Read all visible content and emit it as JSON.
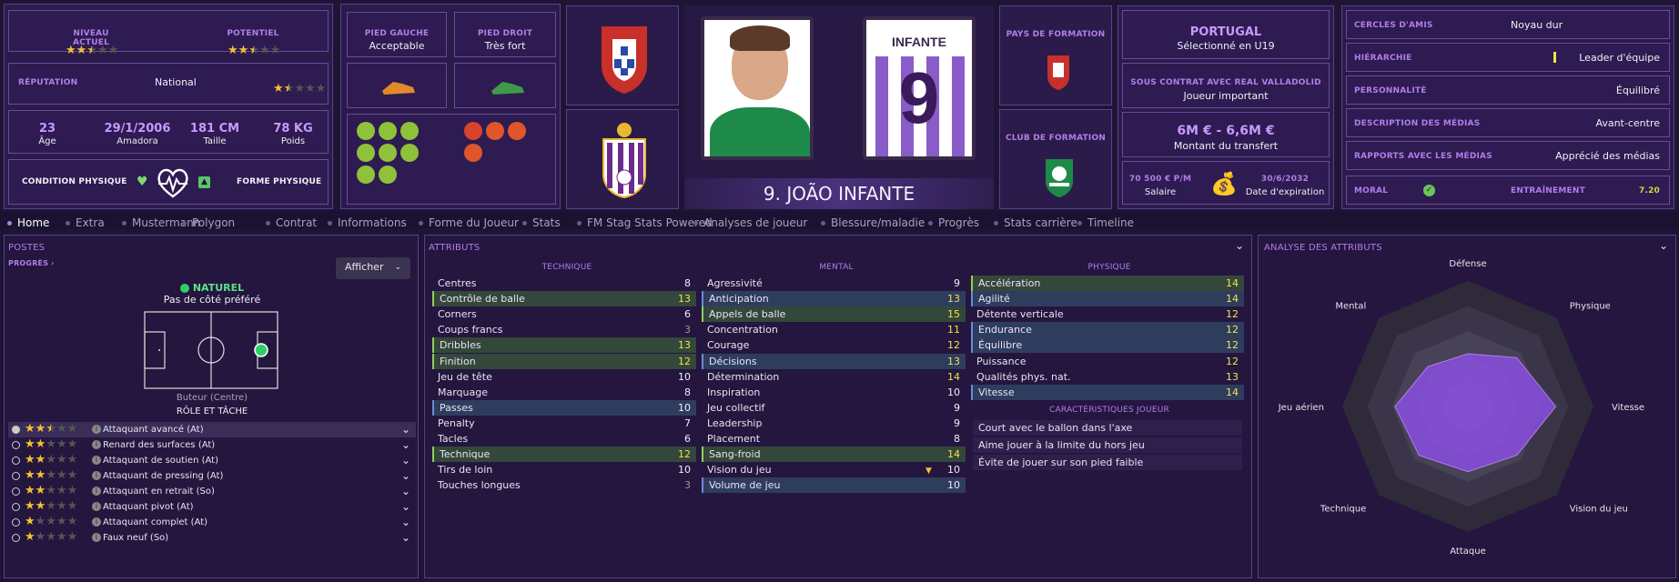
{
  "profile": {
    "current_level_label": "NIVEAU ACTUEL",
    "potential_label": "POTENTIEL",
    "current_stars": 2.5,
    "potential_stars": 2.5,
    "reputation_label": "RÉPUTATION",
    "reputation_value": "National",
    "reputation_stars": 1.5,
    "age": "23",
    "age_label": "Âge",
    "dob": "29/1/2006",
    "birthplace": "Amadora",
    "height": "181 CM",
    "height_label": "Taille",
    "weight": "78 KG",
    "weight_label": "Poids",
    "condition_label": "CONDITION PHYSIQUE",
    "form_label": "FORME PHYSIQUE"
  },
  "feet": {
    "left_label": "PIED GAUCHE",
    "left_value": "Acceptable",
    "right_label": "PIED DROIT",
    "right_value": "Très fort"
  },
  "player": {
    "name": "9. JOÃO INFANTE",
    "shirt_name": "INFANTE",
    "shirt_number": "9"
  },
  "formation": {
    "country_label": "PAYS DE FORMATION",
    "club_label": "CLUB DE FORMATION"
  },
  "contract": {
    "nation": "PORTUGAL",
    "nation_sub": "Sélectionné en U19",
    "contract_label": "SOUS CONTRAT AVEC REAL VALLADOLID",
    "contract_value": "Joueur important",
    "transfer_value": "6M € - 6,6M €",
    "transfer_label": "Montant du transfert",
    "salary": "70 500 € P/M",
    "salary_label": "Salaire",
    "expiry": "30/6/2032",
    "expiry_label": "Date d'expiration"
  },
  "social": {
    "rows": [
      {
        "label": "CERCLES D'AMIS",
        "value": "Noyau dur"
      },
      {
        "label": "HIÉRARCHIE",
        "value": "Leader d'équipe"
      },
      {
        "label": "PERSONNALITÉ",
        "value": "Équilibré"
      },
      {
        "label": "DESCRIPTION DES MÉDIAS",
        "value": "Avant-centre"
      },
      {
        "label": "RAPPORTS AVEC LES MÉDIAS",
        "value": "Apprécié des médias"
      }
    ],
    "morale_label": "MORAL",
    "training_label": "ENTRAÎNEMENT",
    "training_value": "7.20"
  },
  "tabs": [
    "Home",
    "Extra",
    "Mustermann",
    "Polygon",
    "Contrat",
    "Informations",
    "Forme du Joueur",
    "Stats",
    "FM Stag Stats Powered",
    "Analyses de joueur",
    "Blessure/maladie",
    "Progrès",
    "Stats carrière",
    "Timeline"
  ],
  "positions": {
    "title": "POSTES",
    "progress_link": "PROGRÈS",
    "show_button": "Afficher",
    "natural": "NATUREL",
    "side_pref": "Pas de côté préféré",
    "position_name": "Buteur (Centre)",
    "role_title": "RÔLE ET TÂCHE",
    "roles": [
      {
        "name": "Attaquant avancé (At)",
        "stars": 2.5
      },
      {
        "name": "Renard des surfaces (At)",
        "stars": 2
      },
      {
        "name": "Attaquant de soutien (At)",
        "stars": 2
      },
      {
        "name": "Attaquant de pressing (At)",
        "stars": 2
      },
      {
        "name": "Attaquant en retrait (So)",
        "stars": 2
      },
      {
        "name": "Attaquant pivot (At)",
        "stars": 2
      },
      {
        "name": "Attaquant complet (At)",
        "stars": 1
      },
      {
        "name": "Faux neuf (So)",
        "stars": 1
      }
    ]
  },
  "attributes": {
    "title": "ATTRIBUTS",
    "technique_title": "TECHNIQUE",
    "mental_title": "MENTAL",
    "physique_title": "PHYSIQUE",
    "traits_title": "CARACTÉRISTIQUES JOUEUR",
    "technique": [
      {
        "n": "Centres",
        "v": "8",
        "h": ""
      },
      {
        "n": "Contrôle de balle",
        "v": "13",
        "h": "g"
      },
      {
        "n": "Corners",
        "v": "6",
        "h": ""
      },
      {
        "n": "Coups francs",
        "v": "3",
        "h": ""
      },
      {
        "n": "Dribbles",
        "v": "13",
        "h": "g"
      },
      {
        "n": "Finition",
        "v": "12",
        "h": "g"
      },
      {
        "n": "Jeu de tête",
        "v": "10",
        "h": ""
      },
      {
        "n": "Marquage",
        "v": "8",
        "h": ""
      },
      {
        "n": "Passes",
        "v": "10",
        "h": "b"
      },
      {
        "n": "Penalty",
        "v": "7",
        "h": ""
      },
      {
        "n": "Tacles",
        "v": "6",
        "h": ""
      },
      {
        "n": "Technique",
        "v": "12",
        "h": "g"
      },
      {
        "n": "Tirs de loin",
        "v": "10",
        "h": ""
      },
      {
        "n": "Touches longues",
        "v": "3",
        "h": ""
      }
    ],
    "mental": [
      {
        "n": "Agressivité",
        "v": "9",
        "h": ""
      },
      {
        "n": "Anticipation",
        "v": "13",
        "h": "b"
      },
      {
        "n": "Appels de balle",
        "v": "15",
        "h": "g"
      },
      {
        "n": "Concentration",
        "v": "11",
        "h": ""
      },
      {
        "n": "Courage",
        "v": "12",
        "h": ""
      },
      {
        "n": "Décisions",
        "v": "13",
        "h": "b"
      },
      {
        "n": "Détermination",
        "v": "14",
        "h": ""
      },
      {
        "n": "Inspiration",
        "v": "10",
        "h": ""
      },
      {
        "n": "Jeu collectif",
        "v": "9",
        "h": ""
      },
      {
        "n": "Leadership",
        "v": "9",
        "h": ""
      },
      {
        "n": "Placement",
        "v": "8",
        "h": ""
      },
      {
        "n": "Sang-froid",
        "v": "14",
        "h": "g"
      },
      {
        "n": "Vision du jeu",
        "v": "10",
        "h": ""
      },
      {
        "n": "Volume de jeu",
        "v": "10",
        "h": "b"
      }
    ],
    "physique": [
      {
        "n": "Accélération",
        "v": "14",
        "h": "g"
      },
      {
        "n": "Agilité",
        "v": "14",
        "h": "b"
      },
      {
        "n": "Détente verticale",
        "v": "12",
        "h": ""
      },
      {
        "n": "Endurance",
        "v": "12",
        "h": "b"
      },
      {
        "n": "Équilibre",
        "v": "12",
        "h": "b"
      },
      {
        "n": "Puissance",
        "v": "12",
        "h": ""
      },
      {
        "n": "Qualités phys. nat.",
        "v": "13",
        "h": ""
      },
      {
        "n": "Vitesse",
        "v": "14",
        "h": "b"
      }
    ],
    "traits": [
      "Court avec le ballon dans l'axe",
      "Aime jouer à la limite du hors jeu",
      "Évite de jouer sur son pied faible"
    ]
  },
  "analysis": {
    "title": "ANALYSE DES ATTRIBUTS",
    "axes": [
      "Défense",
      "Physique",
      "Vitesse",
      "Vision du jeu",
      "Attaque",
      "Technique",
      "Jeu aérien",
      "Mental"
    ],
    "values": [
      0.42,
      0.55,
      0.7,
      0.55,
      0.52,
      0.55,
      0.58,
      0.45
    ]
  },
  "colors": {
    "accent": "#b07ee8",
    "good": "#8fcf5a",
    "highlight": "#f2e24a"
  }
}
